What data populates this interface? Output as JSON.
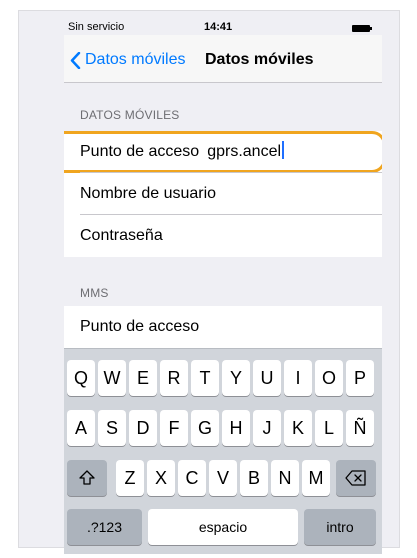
{
  "status_bar": {
    "carrier": "Sin servicio",
    "time": "14:41"
  },
  "nav": {
    "back_label": "Datos móviles",
    "title": "Datos móviles"
  },
  "sections": {
    "datos_moviles": {
      "header": "DATOS MÓVILES",
      "rows": [
        {
          "label": "Punto de acceso",
          "value": "gprs.ancel"
        },
        {
          "label": "Nombre de usuario"
        },
        {
          "label": "Contraseña"
        }
      ]
    },
    "mms": {
      "header": "MMS",
      "rows": [
        {
          "label": "Punto de acceso"
        }
      ]
    }
  },
  "keyboard": {
    "row1": [
      "Q",
      "W",
      "E",
      "R",
      "T",
      "Y",
      "U",
      "I",
      "O",
      "P"
    ],
    "row2": [
      "A",
      "S",
      "D",
      "F",
      "G",
      "H",
      "J",
      "K",
      "L",
      "Ñ"
    ],
    "row3": [
      "Z",
      "X",
      "C",
      "V",
      "B",
      "N",
      "M"
    ],
    "numbers_key": ".?123",
    "space_key": "espacio",
    "return_key": "intro"
  },
  "colors": {
    "accent": "#007aff",
    "highlight": "#f0a51f",
    "cursor": "#1f6fff",
    "background": "#efeff4",
    "keyboard": "#d1d5db"
  },
  "icons": {
    "back": "chevron-left-icon",
    "shift": "shift-icon",
    "delete": "backspace-icon",
    "battery": "battery-icon"
  }
}
